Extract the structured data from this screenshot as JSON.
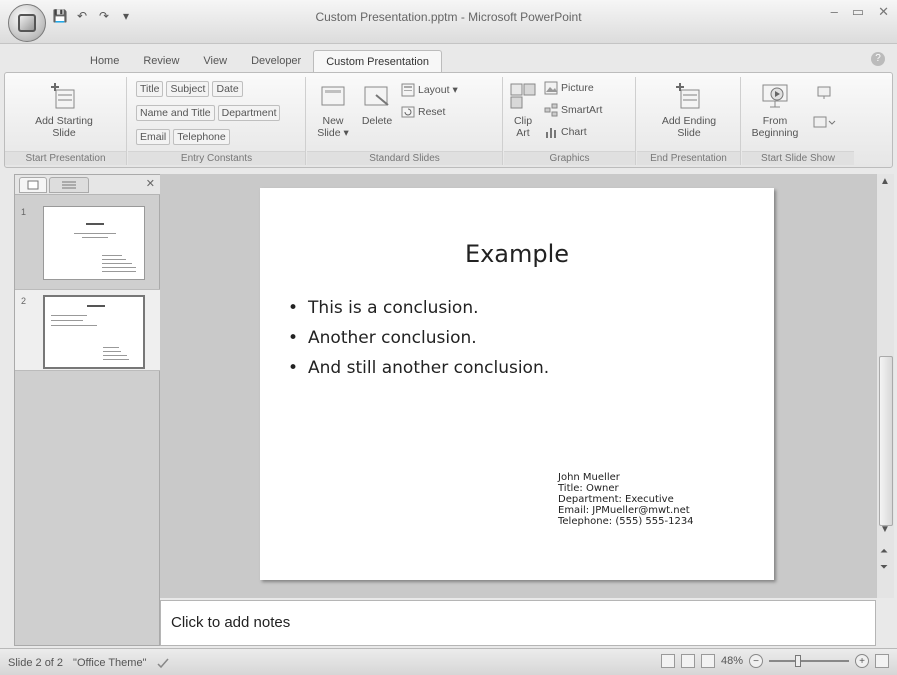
{
  "window": {
    "title": "Custom Presentation.pptm - Microsoft PowerPoint",
    "minimize": "–",
    "restore": "▭",
    "close": "✕"
  },
  "qat": {
    "save": "💾",
    "undo": "↶",
    "redo": "↷",
    "customize": "▾"
  },
  "tabs": {
    "home": "Home",
    "review": "Review",
    "view": "View",
    "developer": "Developer",
    "custom": "Custom Presentation"
  },
  "help": "?",
  "ribbon": {
    "start_presentation": {
      "label": "Start Presentation",
      "add_starting_slide_1": "Add Starting",
      "add_starting_slide_2": "Slide"
    },
    "entry_constants": {
      "label": "Entry Constants",
      "title": "Title",
      "subject": "Subject",
      "date": "Date",
      "name_and_title": "Name and Title",
      "department": "Department",
      "email": "Email",
      "telephone": "Telephone"
    },
    "standard_slides": {
      "label": "Standard Slides",
      "new_slide_1": "New",
      "new_slide_2": "Slide ▾",
      "delete": "Delete",
      "layout": "Layout ▾",
      "reset": "Reset"
    },
    "graphics": {
      "label": "Graphics",
      "clip_art_1": "Clip",
      "clip_art_2": "Art",
      "picture": "Picture",
      "smartart": "SmartArt",
      "chart": "Chart"
    },
    "end_presentation": {
      "label": "End Presentation",
      "add_ending_slide_1": "Add Ending",
      "add_ending_slide_2": "Slide"
    },
    "start_slide_show": {
      "label": "Start Slide Show",
      "from_beginning_1": "From",
      "from_beginning_2": "Beginning"
    }
  },
  "thumbnails": [
    {
      "number": "1"
    },
    {
      "number": "2"
    }
  ],
  "slide": {
    "title": "Example",
    "bullets": [
      "This is a conclusion.",
      "Another conclusion.",
      "And still another conclusion."
    ],
    "contact": {
      "name": "John Mueller",
      "title": "Title: Owner",
      "department": "Department: Executive",
      "email": "Email: JPMueller@mwt.net",
      "telephone": "Telephone: (555) 555-1234"
    }
  },
  "notes": {
    "placeholder": "Click to add notes"
  },
  "status": {
    "slide_count": "Slide 2 of 2",
    "theme": "\"Office Theme\"",
    "zoom": "48%",
    "zoom_out": "−",
    "zoom_in": "+"
  }
}
